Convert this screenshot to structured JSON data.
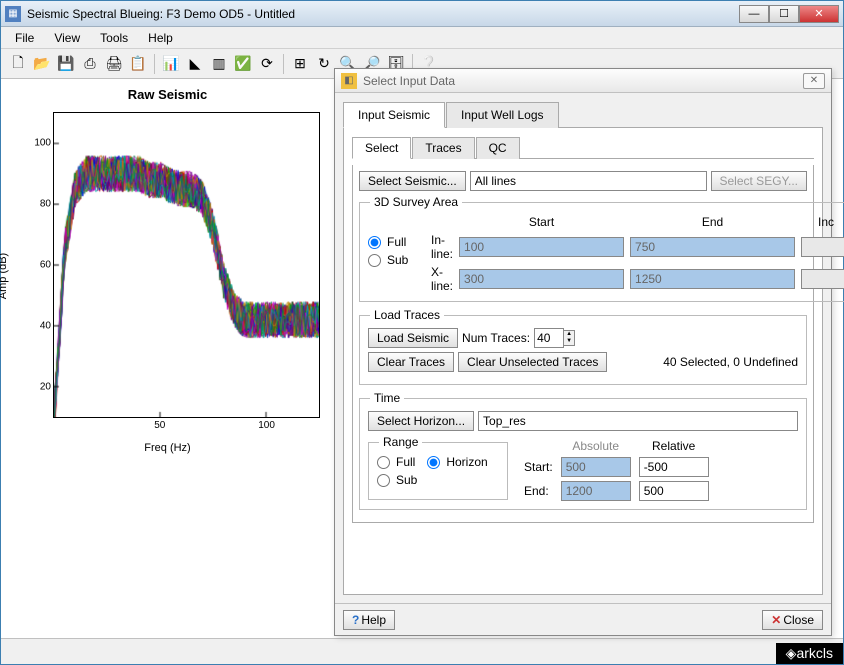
{
  "window": {
    "title": "Seismic Spectral Blueing: F3 Demo OD5 - Untitled"
  },
  "menu": {
    "file": "File",
    "view": "View",
    "tools": "Tools",
    "help": "Help"
  },
  "dialog": {
    "title": "Select Input Data",
    "tab_seismic": "Input Seismic",
    "tab_welllogs": "Input Well Logs",
    "subtab_select": "Select",
    "subtab_traces": "Traces",
    "subtab_qc": "QC",
    "select_seismic_btn": "Select Seismic...",
    "select_seismic_value": "All lines",
    "select_segy_btn": "Select SEGY...",
    "survey_legend": "3D Survey Area",
    "radio_full": "Full",
    "radio_sub": "Sub",
    "col_start": "Start",
    "col_end": "End",
    "col_inc": "Inc",
    "row_inline": "In-line:",
    "row_xline": "X-line:",
    "inline_start": "100",
    "inline_end": "750",
    "inline_inc": "",
    "xline_start": "300",
    "xline_end": "1250",
    "xline_inc": "",
    "loadtraces_legend": "Load Traces",
    "load_seismic_btn": "Load Seismic",
    "num_traces_label": "Num Traces:",
    "num_traces_value": "40",
    "clear_traces_btn": "Clear Traces",
    "clear_unsel_btn": "Clear Unselected Traces",
    "status_text": "40 Selected, 0 Undefined",
    "time_legend": "Time",
    "select_horizon_btn": "Select Horizon...",
    "horizon_value": "Top_res",
    "range_legend": "Range",
    "range_full": "Full",
    "range_horizon": "Horizon",
    "range_sub": "Sub",
    "absolute_label": "Absolute",
    "relative_label": "Relative",
    "start_label": "Start:",
    "end_label": "End:",
    "abs_start": "500",
    "abs_end": "1200",
    "rel_start": "-500",
    "rel_end": "500",
    "help_btn": "Help",
    "close_btn": "Close"
  },
  "footer": {
    "brand": "◈arkcls"
  },
  "chart_data": {
    "type": "line",
    "title": "Raw Seismic",
    "xlabel": "Freq (Hz)",
    "ylabel": "Amp (dB)",
    "xlim": [
      0,
      125
    ],
    "ylim": [
      10,
      110
    ],
    "x_ticks": [
      50,
      100
    ],
    "y_ticks": [
      20,
      40,
      60,
      80,
      100
    ],
    "n_series": 40,
    "series_template": {
      "x": [
        1,
        5,
        10,
        15,
        20,
        25,
        30,
        35,
        40,
        45,
        50,
        55,
        60,
        65,
        70,
        75,
        80,
        85,
        90,
        95,
        100,
        105,
        110,
        115,
        120,
        125
      ],
      "y_mean": [
        20,
        65,
        85,
        90,
        90,
        90,
        90,
        90,
        90,
        88,
        88,
        86,
        85,
        85,
        82,
        72,
        55,
        45,
        42,
        42,
        42,
        42,
        42,
        42,
        42,
        42
      ],
      "y_noise": 12
    },
    "palette": [
      "#d00",
      "#0a0",
      "#00d",
      "#c0c",
      "#0aa",
      "#b80",
      "#608",
      "#084",
      "#840",
      "#a0a",
      "#06c",
      "#c60",
      "#088",
      "#808",
      "#480",
      "#804"
    ]
  }
}
